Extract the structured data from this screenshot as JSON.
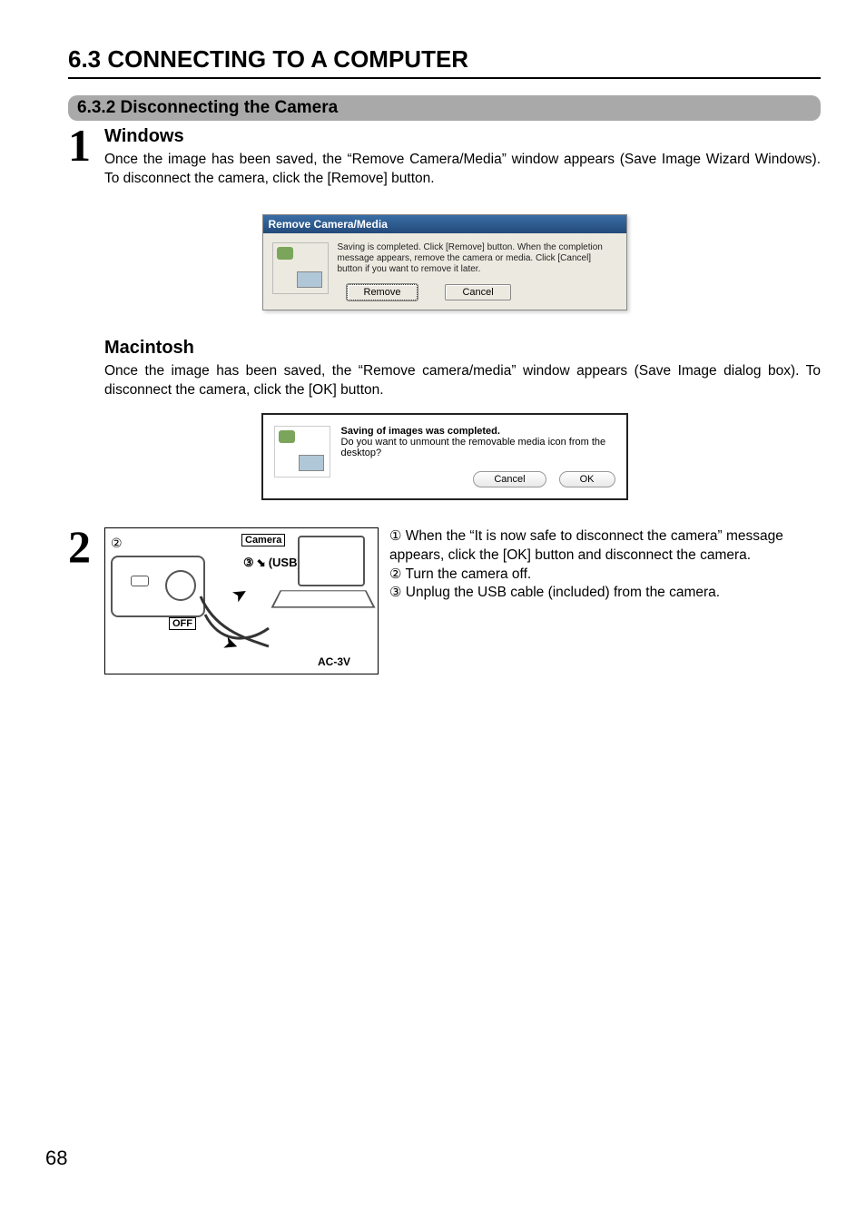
{
  "section_title": "6.3 CONNECTING TO A COMPUTER",
  "subsection_title": "6.3.2 Disconnecting the Camera",
  "step1": {
    "number": "1",
    "windows": {
      "heading": "Windows",
      "body": "Once the image has been saved, the “Remove Camera/Media” window appears (Save Image Wizard Windows). To disconnect the camera, click the [Remove] button.",
      "dialog": {
        "title": "Remove Camera/Media",
        "message": "Saving is completed. Click [Remove] button. When the completion message appears, remove the camera or media. Click [Cancel] button if you want to remove it later.",
        "remove_btn": "Remove",
        "cancel_btn": "Cancel"
      }
    },
    "mac": {
      "heading": "Macintosh",
      "body": "Once the image has been saved, the “Remove camera/media” window appears (Save Image dialog box). To disconnect the camera, click the [OK] button.",
      "dialog": {
        "line1": "Saving of images was completed.",
        "line2": "Do you want to unmount the removable media icon from the desktop?",
        "cancel_btn": "Cancel",
        "ok_btn": "OK"
      }
    }
  },
  "step2": {
    "number": "2",
    "figure": {
      "camera_label": "Camera",
      "usb_label": "(USB)socket",
      "off_label": "OFF",
      "ac_label": "AC-3V",
      "circ2": "②",
      "circ3": "③",
      "usb_glyph": "←•"
    },
    "list": {
      "item1_marker": "①",
      "item1": "When the “It is now safe to disconnect the camera” message appears, click the [OK] button and disconnect the camera.",
      "item2_marker": "②",
      "item2": "Turn the camera off.",
      "item3_marker": "③",
      "item3": "Unplug the USB cable (included) from the camera."
    }
  },
  "page_number": "68"
}
